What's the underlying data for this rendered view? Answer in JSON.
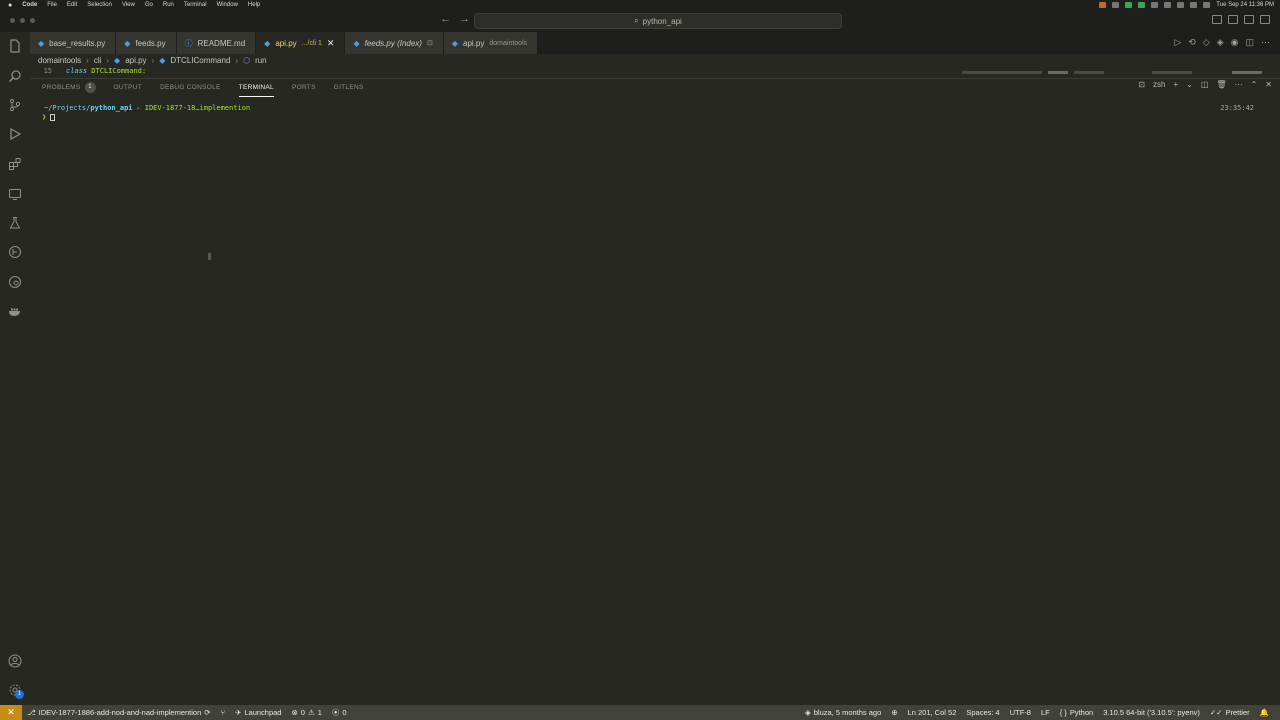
{
  "menubar": {
    "app": "Code",
    "items": [
      "File",
      "Edit",
      "Selection",
      "View",
      "Go",
      "Run",
      "Terminal",
      "Window",
      "Help"
    ],
    "clock": "Tue Sep 24  11:36 PM"
  },
  "titlebar": {
    "search": "python_api"
  },
  "activitybar": {
    "icons": [
      "files-icon",
      "search-icon",
      "source-control-icon",
      "run-debug-icon",
      "extensions-icon",
      "remote-explorer-icon",
      "testing-icon",
      "gitlens-icon",
      "gitlens-inspect-icon",
      "docker-icon"
    ],
    "settings_badge": "1"
  },
  "tabs": [
    {
      "name": "base_results.py",
      "desc": "",
      "icon": "py",
      "active": false,
      "italic": false
    },
    {
      "name": "feeds.py",
      "desc": "",
      "icon": "py",
      "active": false,
      "italic": false
    },
    {
      "name": "README.md",
      "desc": "",
      "icon": "info",
      "active": false,
      "italic": false
    },
    {
      "name": "api.py",
      "desc": ".../cli 1",
      "icon": "py",
      "active": true,
      "italic": false
    },
    {
      "name": "feeds.py (Index)",
      "desc": "",
      "icon": "py",
      "active": false,
      "italic": true
    },
    {
      "name": "api.py",
      "desc": "domaintools",
      "icon": "py",
      "active": false,
      "italic": false
    }
  ],
  "breadcrumb": {
    "parts": [
      "domaintools",
      "cli",
      "api.py",
      "DTCLICommand",
      "run"
    ]
  },
  "code": {
    "line_number": "15",
    "keyword": "class",
    "class_name": "DTCLICommand:"
  },
  "panel": {
    "tabs": [
      {
        "label": "PROBLEMS",
        "badge": "1",
        "active": false
      },
      {
        "label": "OUTPUT",
        "badge": "",
        "active": false
      },
      {
        "label": "DEBUG CONSOLE",
        "badge": "",
        "active": false
      },
      {
        "label": "TERMINAL",
        "badge": "",
        "active": true
      },
      {
        "label": "PORTS",
        "badge": "",
        "active": false
      },
      {
        "label": "GITLENS",
        "badge": "",
        "active": false
      }
    ],
    "shell": "zsh"
  },
  "terminal": {
    "path_prefix": "~/Projects/",
    "path_repo": "python_api",
    "branch": "IDEV-1877-18…implemention",
    "prompt_symbol": "❯",
    "time": "23:35:42"
  },
  "statusbar": {
    "branch": "IDEV-1877-1886-add-nod-and-nad-implemention",
    "launchpad": "Launchpad",
    "errors": "0",
    "warnings": "1",
    "ports": "0",
    "blame": "bluza, 5 months ago",
    "position": "Ln 201, Col 52",
    "spaces": "Spaces: 4",
    "encoding": "UTF-8",
    "eol": "LF",
    "language": "Python",
    "interpreter": "3.10.5 64-bit ('3.10.5': pyenv)",
    "prettier": "Prettier"
  },
  "colors": {
    "background": "#272822",
    "statusbar": "#414339",
    "remote": "#c88b16",
    "accent": "#e6db74"
  }
}
